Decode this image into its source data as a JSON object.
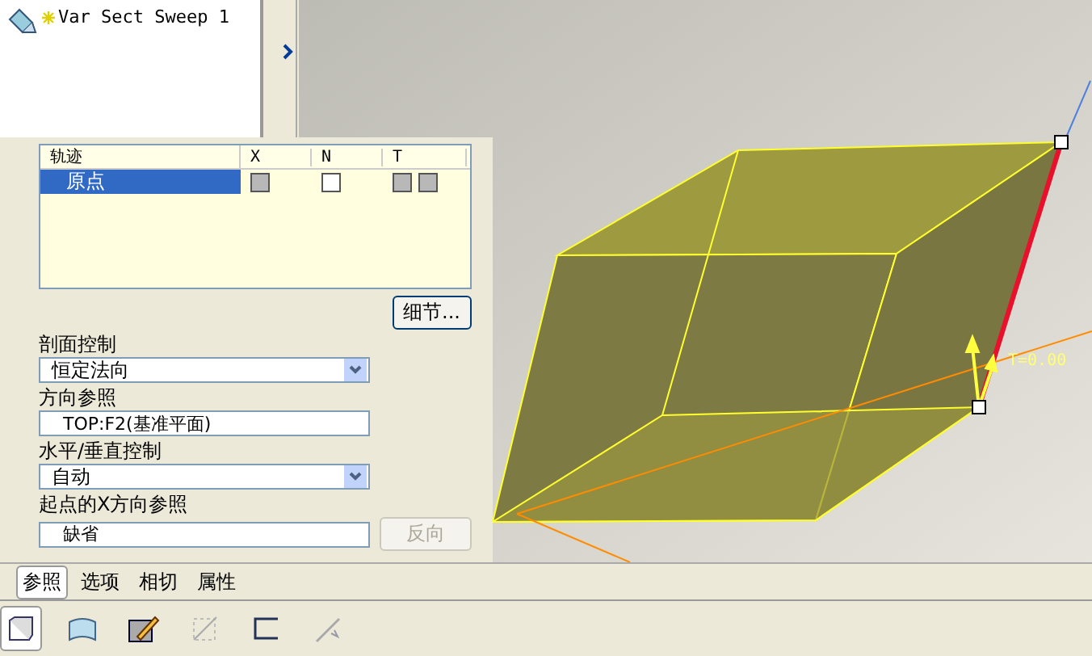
{
  "model_tree": {
    "items": [
      {
        "label": "Var Sect Sweep 1"
      }
    ]
  },
  "trajectory_table": {
    "columns": [
      "轨迹",
      "X",
      "N",
      "T"
    ],
    "rows": [
      {
        "name": "原点",
        "selected": true,
        "x_disabled": true,
        "n_disabled": false,
        "t_disabled": [
          true,
          true
        ]
      }
    ]
  },
  "details_button": "细节...",
  "fields": [
    {
      "label": "剖面控制",
      "kind": "dropdown",
      "value": "恒定法向"
    },
    {
      "label": "方向参照",
      "kind": "text",
      "value": "TOP:F2(基准平面)"
    },
    {
      "label": "水平/垂直控制",
      "kind": "dropdown",
      "value": "自动"
    },
    {
      "label": "起点的X方向参照",
      "kind": "text",
      "value": "缺省",
      "button": {
        "label": "反向",
        "disabled": true
      }
    }
  ],
  "tabs": [
    {
      "label": "参照",
      "selected": true
    },
    {
      "label": "选项",
      "selected": false
    },
    {
      "label": "相切",
      "selected": false
    },
    {
      "label": "属性",
      "selected": false
    }
  ],
  "toolbar": [
    {
      "kind": "solid",
      "selected": true
    },
    {
      "kind": "surface",
      "selected": false
    },
    {
      "kind": "sketch",
      "selected": false
    },
    {
      "kind": "trim",
      "selected": false
    },
    {
      "kind": "thin",
      "selected": false
    },
    {
      "kind": "path",
      "selected": false
    }
  ],
  "viewport": {
    "annotation": "T=0.00"
  }
}
